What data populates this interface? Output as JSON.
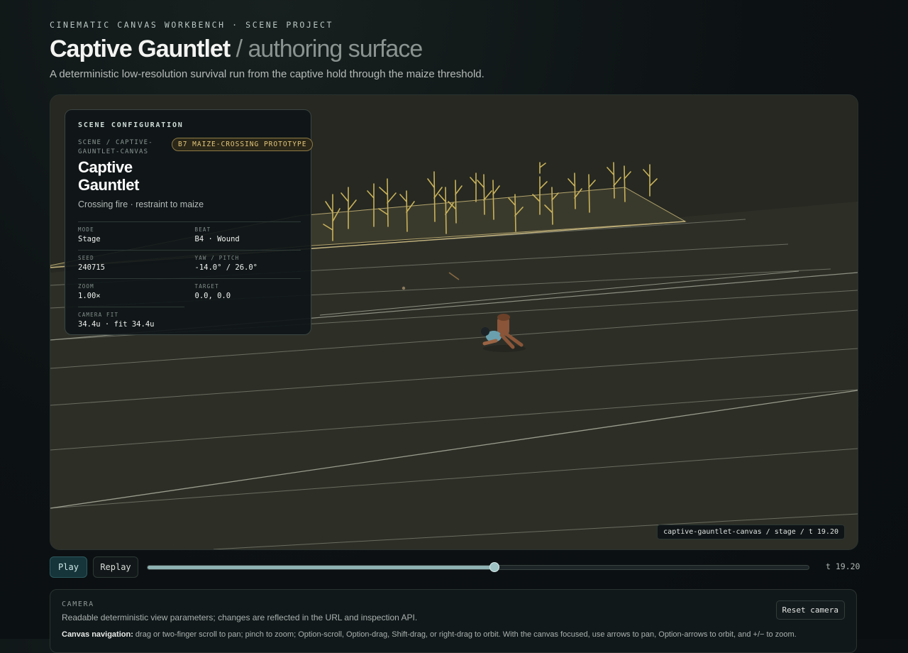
{
  "header": {
    "eyebrow": "CINEMATIC CANVAS WORKBENCH · SCENE PROJECT",
    "title": "Captive Gauntlet",
    "title_suffix": " / authoring surface",
    "subtitle": "A deterministic low-resolution survival run from the captive hold through the maize threshold."
  },
  "scene_config": {
    "heading": "SCENE CONFIGURATION",
    "path": "SCENE / CAPTIVE-GAUNTLET-CANVAS",
    "badge": "B7 MAIZE-CROSSING PROTOTYPE",
    "name": "Captive Gauntlet",
    "description": "Crossing fire · restraint to maize",
    "fields": {
      "mode": {
        "label": "MODE",
        "value": "Stage"
      },
      "beat": {
        "label": "BEAT",
        "value": "B4 · Wound"
      },
      "seed": {
        "label": "SEED",
        "value": "240715"
      },
      "yaw_pitch": {
        "label": "YAW / PITCH",
        "value": "-14.0° / 26.0°"
      },
      "zoom": {
        "label": "ZOOM",
        "value": "1.00×"
      },
      "target": {
        "label": "TARGET",
        "value": "0.0, 0.0"
      },
      "camera_fit": {
        "label": "CAMERA FIT",
        "value": "34.4u · fit 34.4u"
      }
    }
  },
  "stage_tag": "captive-gauntlet-canvas / stage / t 19.20",
  "playback": {
    "play_label": "Play",
    "replay_label": "Replay",
    "progress": 0.525,
    "time_readout": "t 19.20"
  },
  "camera_panel": {
    "heading": "CAMERA",
    "description": "Readable deterministic view parameters; changes are reflected in the URL and inspection API.",
    "reset_label": "Reset camera",
    "nav_label": "Canvas navigation:",
    "nav_text": " drag or two-finger scroll to pan; pinch to zoom; Option-scroll, Option-drag, Shift-drag, or right-drag to orbit. With the canvas focused, use arrows to pan, Option-arrows to orbit, and +/− to zoom."
  },
  "colors": {
    "accent": "#8fb2b3",
    "badge": "#e3c77a",
    "maize": "#c9b25a",
    "ground": "#2d2f27",
    "figure_skin": "#8a5538",
    "figure_shirt": "#6aa0ae"
  }
}
